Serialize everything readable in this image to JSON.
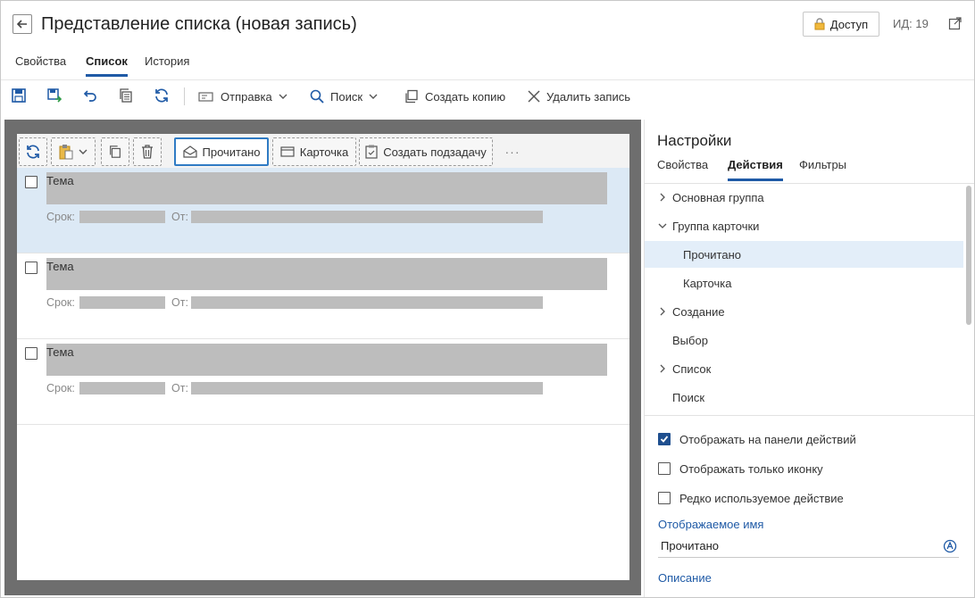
{
  "header": {
    "title": "Представление списка (новая запись)",
    "access_label": "Доступ",
    "id_label": "ИД: 19"
  },
  "tabs": [
    {
      "label": "Свойства"
    },
    {
      "label": "Список"
    },
    {
      "label": "История"
    }
  ],
  "toolbar": {
    "send_label": "Отправка",
    "search_label": "Поиск",
    "copy_label": "Создать копию",
    "delete_label": "Удалить запись"
  },
  "preview": {
    "toolbar": {
      "read_label": "Прочитано",
      "card_label": "Карточка",
      "subtask_label": "Создать подзадачу",
      "more_label": "···"
    },
    "rows": [
      {
        "subject": "Тема",
        "due_label": "Срок:",
        "from_label": "От:"
      },
      {
        "subject": "Тема",
        "due_label": "Срок:",
        "from_label": "От:"
      },
      {
        "subject": "Тема",
        "due_label": "Срок:",
        "from_label": "От:"
      }
    ]
  },
  "settings": {
    "title": "Настройки",
    "tabs": [
      {
        "label": "Свойства"
      },
      {
        "label": "Действия"
      },
      {
        "label": "Фильтры"
      }
    ],
    "tree": [
      {
        "label": "Основная группа"
      },
      {
        "label": "Группа карточки"
      },
      {
        "label": "Прочитано"
      },
      {
        "label": "Карточка"
      },
      {
        "label": "Создание"
      },
      {
        "label": "Выбор"
      },
      {
        "label": "Список"
      },
      {
        "label": "Поиск"
      }
    ],
    "options": [
      {
        "label": "Отображать на панели действий",
        "checked": true
      },
      {
        "label": "Отображать только иконку",
        "checked": false
      },
      {
        "label": "Редко используемое действие",
        "checked": false
      }
    ],
    "display_name_label": "Отображаемое имя",
    "display_name_value": "Прочитано",
    "description_label": "Описание"
  },
  "colors": {
    "accent": "#1f5aa6",
    "selection": "#dce9f5",
    "preview_bg": "#6e6e6e",
    "placeholder": "#bdbdbd"
  }
}
